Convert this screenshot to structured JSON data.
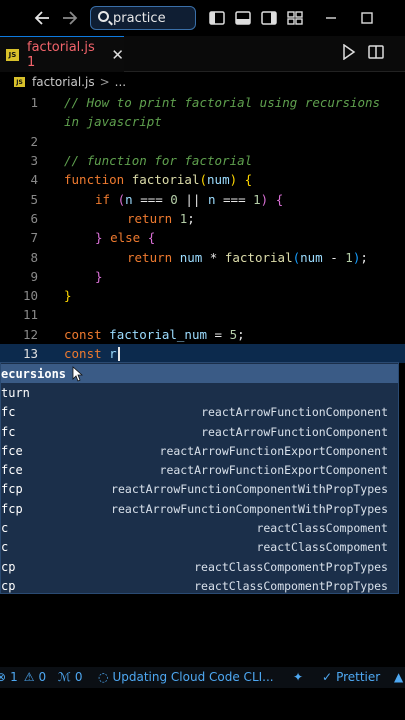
{
  "titlebar": {
    "search_label": "practice",
    "icons": [
      "back-arrow-icon",
      "forward-arrow-icon",
      "search-icon",
      "layout-sidebar-icon",
      "layout-panel-icon",
      "layout-secondary-icon",
      "customize-layout-icon",
      "minimize-icon",
      "maximize-icon"
    ]
  },
  "tab": {
    "badge": "JS",
    "label": "factorial.js 1",
    "close": "✕"
  },
  "breadcrumb": {
    "badge": "JS",
    "file": "factorial.js",
    "separator": ">",
    "rest": "..."
  },
  "editor": {
    "lines": [
      {
        "num": "1",
        "text": "// How to print factorial using recursions"
      },
      {
        "num": "",
        "text": "in javascript"
      },
      {
        "num": "2",
        "text": ""
      },
      {
        "num": "3",
        "text": "// function for factorial"
      },
      {
        "num": "4",
        "text": "function factorial(num) {"
      },
      {
        "num": "5",
        "text": "if (n === 0 || n === 1) {"
      },
      {
        "num": "6",
        "text": "return 1;"
      },
      {
        "num": "7",
        "text": "} else {"
      },
      {
        "num": "8",
        "text": "return num * factorial(num - 1);"
      },
      {
        "num": "9",
        "text": "}"
      },
      {
        "num": "10",
        "text": "}"
      },
      {
        "num": "11",
        "text": ""
      },
      {
        "num": "12",
        "text": "const factorial_num = 5;"
      },
      {
        "num": "13",
        "text": "const r"
      }
    ]
  },
  "suggest": {
    "items": [
      {
        "label": "ecursions",
        "detail": ""
      },
      {
        "label": "turn",
        "detail": ""
      },
      {
        "label": "fc",
        "detail": "reactArrowFunctionComponent"
      },
      {
        "label": "fc",
        "detail": "reactArrowFunctionComponent"
      },
      {
        "label": "fce",
        "detail": "reactArrowFunctionExportComponent"
      },
      {
        "label": "fce",
        "detail": "reactArrowFunctionExportComponent"
      },
      {
        "label": "fcp",
        "detail": "reactArrowFunctionComponentWithPropTypes"
      },
      {
        "label": "fcp",
        "detail": "reactArrowFunctionComponentWithPropTypes"
      },
      {
        "label": "c",
        "detail": "reactClassCompoment"
      },
      {
        "label": "c",
        "detail": "reactClassCompoment"
      },
      {
        "label": "cp",
        "detail": "reactClassCompomentPropTypes"
      },
      {
        "label": "cp",
        "detail": "reactClassCompomentPropTypes"
      }
    ]
  },
  "statusbar": {
    "errors": "1",
    "warnings": "0",
    "ports": "0",
    "cloud_status": "Updating Cloud Code CLI...",
    "prettier": "Prettier"
  },
  "colors": {
    "accent": "#0e7adf",
    "tab_error_text": "#f3646b",
    "suggest_bg": "#1b2f4a",
    "suggest_selected": "#3a5b86",
    "status_text": "#4ea8f2"
  }
}
